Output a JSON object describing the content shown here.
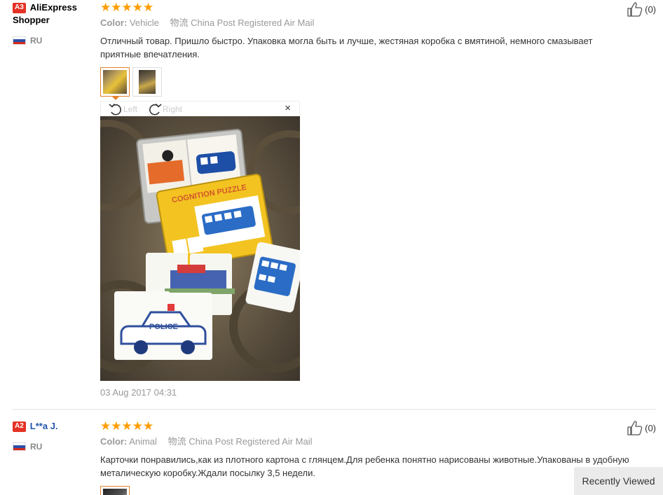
{
  "reviews": [
    {
      "badge": "A3",
      "user": "AliExpress Shopper",
      "country": "RU",
      "stars": "★★★★★",
      "color_label": "Color:",
      "color_value": "Vehicle",
      "shipping_icon": "物流",
      "shipping": "China Post Registered Air Mail",
      "text": "Отличный товар. Пришло быстро. Упаковка могла быть и лучше, жестяная коробка с вмятиной, немного смазывает приятные впечатления.",
      "viewer": {
        "left_label": "Left",
        "right_label": "Right",
        "close": "×"
      },
      "date": "03 Aug 2017 04:31",
      "likes": "(0)"
    },
    {
      "badge": "A2",
      "user": "L**a J.",
      "country": "RU",
      "stars": "★★★★★",
      "color_label": "Color:",
      "color_value": "Animal",
      "shipping_icon": "物流",
      "shipping": "China Post Registered Air Mail",
      "text": "Карточки понравились,как из плотного картона с глянцем.Для ребенка понятно нарисованы животные.Упакованы в удобную металическую коробку.Ждали посылку 3,5 недели.",
      "likes": "(0)"
    }
  ],
  "photo_texts": {
    "box_title": "COGNITION PUZZLE",
    "card_label": "POLICE"
  },
  "recently_viewed": "Recently Viewed",
  "colors": {
    "star": "#ff9c00",
    "badge": "#e43225",
    "active_thumb": "#e5822d",
    "link": "#1f55a8"
  }
}
